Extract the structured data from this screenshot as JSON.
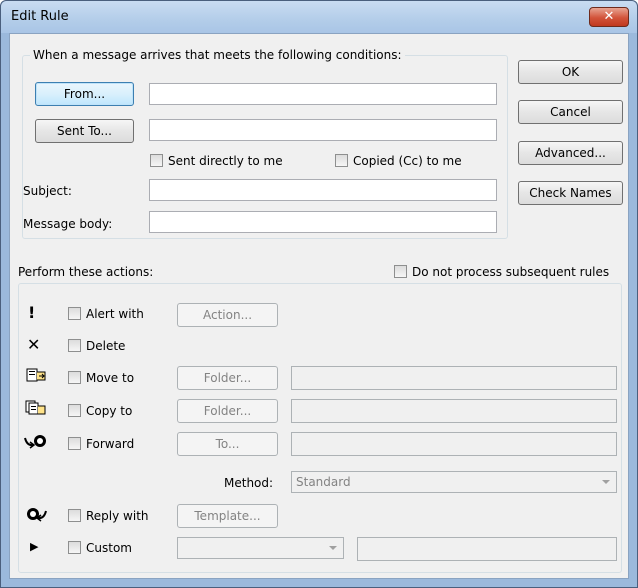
{
  "window": {
    "title": "Edit Rule",
    "close_glyph": "✕"
  },
  "conditions": {
    "heading": "When a message arrives that meets the following conditions:",
    "from_button": "From...",
    "from_value": "",
    "sent_to_button": "Sent To...",
    "sent_to_value": "",
    "sent_directly_label": "Sent directly to me",
    "copied_label": "Copied (Cc) to me",
    "subject_label": "Subject:",
    "subject_value": "",
    "body_label": "Message body:",
    "body_value": ""
  },
  "side_buttons": {
    "ok": "OK",
    "cancel": "Cancel",
    "advanced": "Advanced...",
    "check_names": "Check Names"
  },
  "actions": {
    "heading": "Perform these actions:",
    "do_not_process_label": "Do not process subsequent rules",
    "alert": {
      "icon": "exclamation-icon",
      "label": "Alert with",
      "button": "Action..."
    },
    "delete": {
      "icon": "delete-x-icon",
      "label": "Delete"
    },
    "move": {
      "icon": "move-to-folder-icon",
      "label": "Move to",
      "button": "Folder...",
      "value": ""
    },
    "copy": {
      "icon": "copy-to-folder-icon",
      "label": "Copy to",
      "button": "Folder...",
      "value": ""
    },
    "forward": {
      "icon": "forward-icon",
      "label": "Forward",
      "button": "To...",
      "value": ""
    },
    "method": {
      "label": "Method:",
      "value": "Standard"
    },
    "reply": {
      "icon": "reply-icon",
      "label": "Reply with",
      "button": "Template..."
    },
    "custom": {
      "icon": "play-arrow-icon",
      "label": "Custom",
      "select_value": "",
      "value": ""
    }
  }
}
